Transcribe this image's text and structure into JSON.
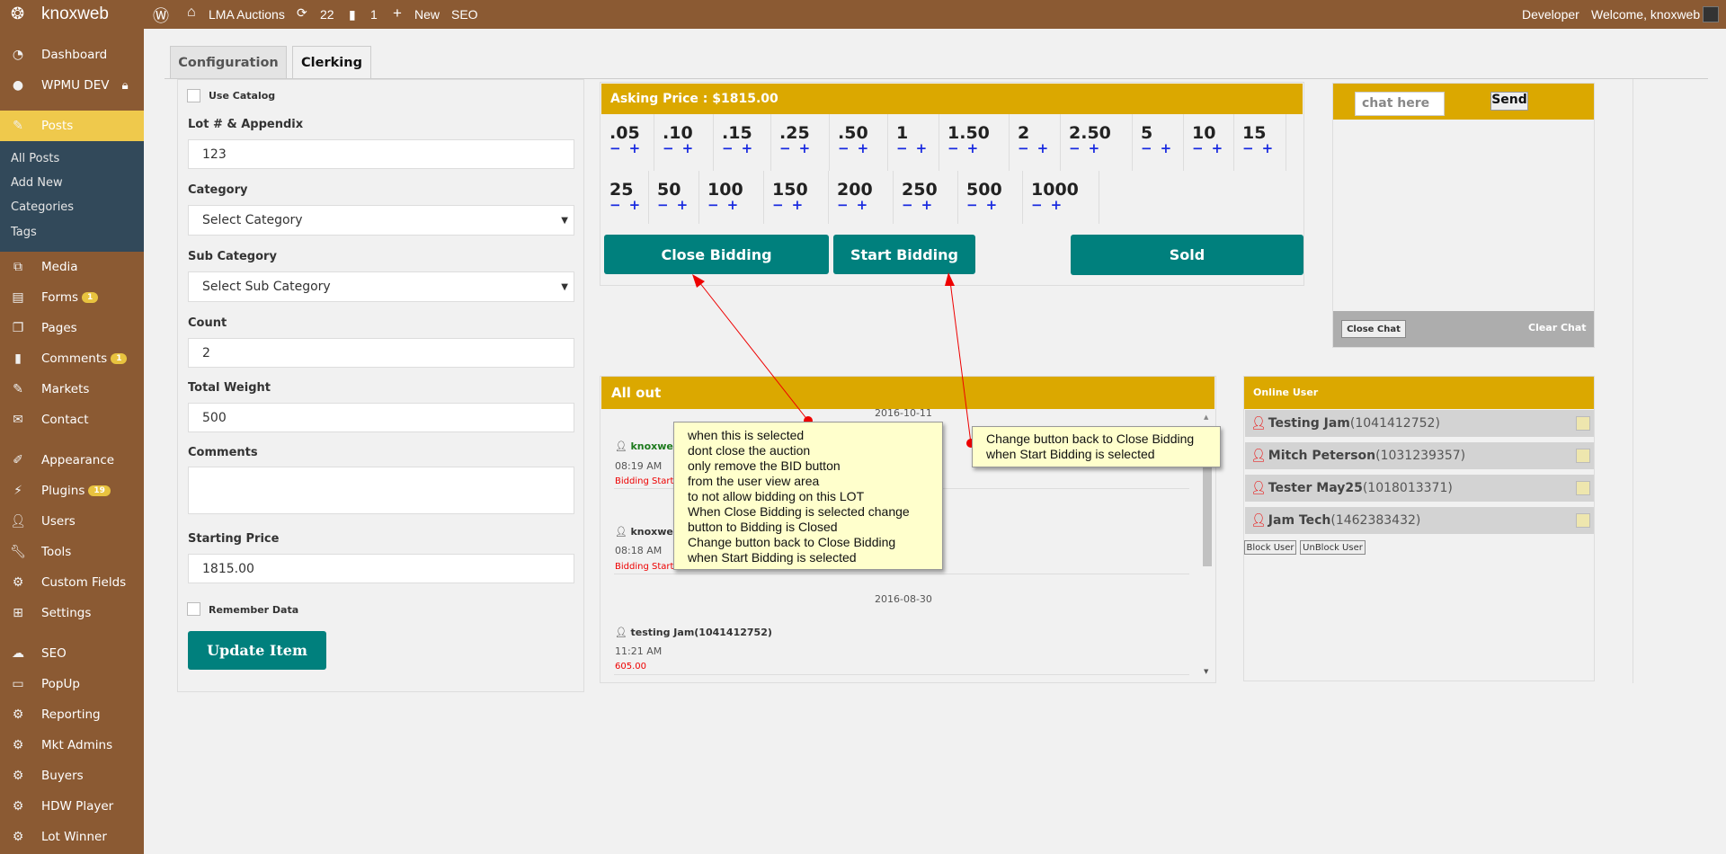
{
  "topbar": {
    "site": "knoxweb",
    "home": "LMA Auctions",
    "updates": "22",
    "comments": "1",
    "new": "New",
    "seo": "SEO",
    "developer": "Developer",
    "welcome": "Welcome, knoxweb"
  },
  "sidebar": {
    "top": [
      {
        "label": "Dashboard"
      },
      {
        "label": "WPMU DEV"
      }
    ],
    "posts": "Posts",
    "posts_sub": [
      "All Posts",
      "Add New",
      "Categories",
      "Tags"
    ],
    "items": [
      {
        "label": "Media"
      },
      {
        "label": "Forms",
        "badge": "1"
      },
      {
        "label": "Pages"
      },
      {
        "label": "Comments",
        "badge": "1"
      },
      {
        "label": "Markets"
      },
      {
        "label": "Contact"
      },
      {
        "label": "Appearance"
      },
      {
        "label": "Plugins",
        "badge": "19"
      },
      {
        "label": "Users"
      },
      {
        "label": "Tools"
      },
      {
        "label": "Custom Fields"
      },
      {
        "label": "Settings"
      },
      {
        "label": "SEO"
      },
      {
        "label": "PopUp"
      },
      {
        "label": "Reporting"
      },
      {
        "label": "Mkt Admins"
      },
      {
        "label": "Buyers"
      },
      {
        "label": "HDW Player"
      },
      {
        "label": "Lot Winner"
      }
    ]
  },
  "tabs": [
    "Configuration",
    "Clerking"
  ],
  "form": {
    "use_catalog": "Use Catalog",
    "lot_label": "Lot # & Appendix",
    "lot_value": "123",
    "category_label": "Category",
    "category_value": "Select Category",
    "subcategory_label": "Sub Category",
    "subcategory_value": "Select Sub Category",
    "count_label": "Count",
    "count_value": "2",
    "weight_label": "Total Weight",
    "weight_value": "500",
    "comments_label": "Comments",
    "comments_value": "",
    "price_label": "Starting Price",
    "price_value": "1815.00",
    "remember": "Remember Data",
    "update": "Update Item"
  },
  "bidding": {
    "asking": "Asking Price : $1815.00",
    "row1": [
      ".05",
      ".10",
      ".15",
      ".25",
      ".50",
      "1",
      "1.50",
      "2",
      "2.50",
      "5",
      "10",
      "15"
    ],
    "row2": [
      "25",
      "50",
      "100",
      "150",
      "200",
      "250",
      "500",
      "1000"
    ],
    "minus": "−",
    "plus": "+",
    "close": "Close Bidding",
    "start": "Start Bidding",
    "sold": "Sold"
  },
  "allout": {
    "title": "All out",
    "date1": "2016-10-11",
    "entries": [
      {
        "name": "knoxwe",
        "time": "08:19 AM",
        "text": "Bidding Start"
      },
      {
        "name": "knoxwe",
        "time": "08:18 AM",
        "text": "Bidding Start"
      }
    ],
    "date2": "2016-08-30",
    "entry3": {
      "name": "testing Jam(1041412752)",
      "time": "11:21 AM",
      "text": "605.00"
    }
  },
  "chat": {
    "placeholder": "chat here",
    "send": "Send",
    "close": "Close Chat",
    "clear": "Clear Chat"
  },
  "online": {
    "title": "Online User",
    "users": [
      {
        "name": "Testing Jam",
        "id": "(1041412752)"
      },
      {
        "name": "Mitch Peterson",
        "id": "(1031239357)"
      },
      {
        "name": "Tester May25",
        "id": "(1018013371)"
      },
      {
        "name": "Jam Tech",
        "id": "(1462383432)"
      }
    ],
    "block": "Block User",
    "unblock": "UnBlock User"
  },
  "notes": {
    "note1": [
      "when this is selected",
      "dont close the auction",
      "only remove the BID button",
      "from the user view area",
      "to not allow bidding on this LOT",
      "When Close Bidding is selected change",
      "button to Bidding is Closed",
      "Change button back to Close Bidding",
      "when Start Bidding is selected"
    ],
    "note2": [
      "Change button back to Close Bidding",
      "when Start Bidding is selected"
    ]
  },
  "colors": {
    "brown": "#8b5a33",
    "gold": "#dba800",
    "teal": "#00807d",
    "posts": "#efc94c"
  }
}
